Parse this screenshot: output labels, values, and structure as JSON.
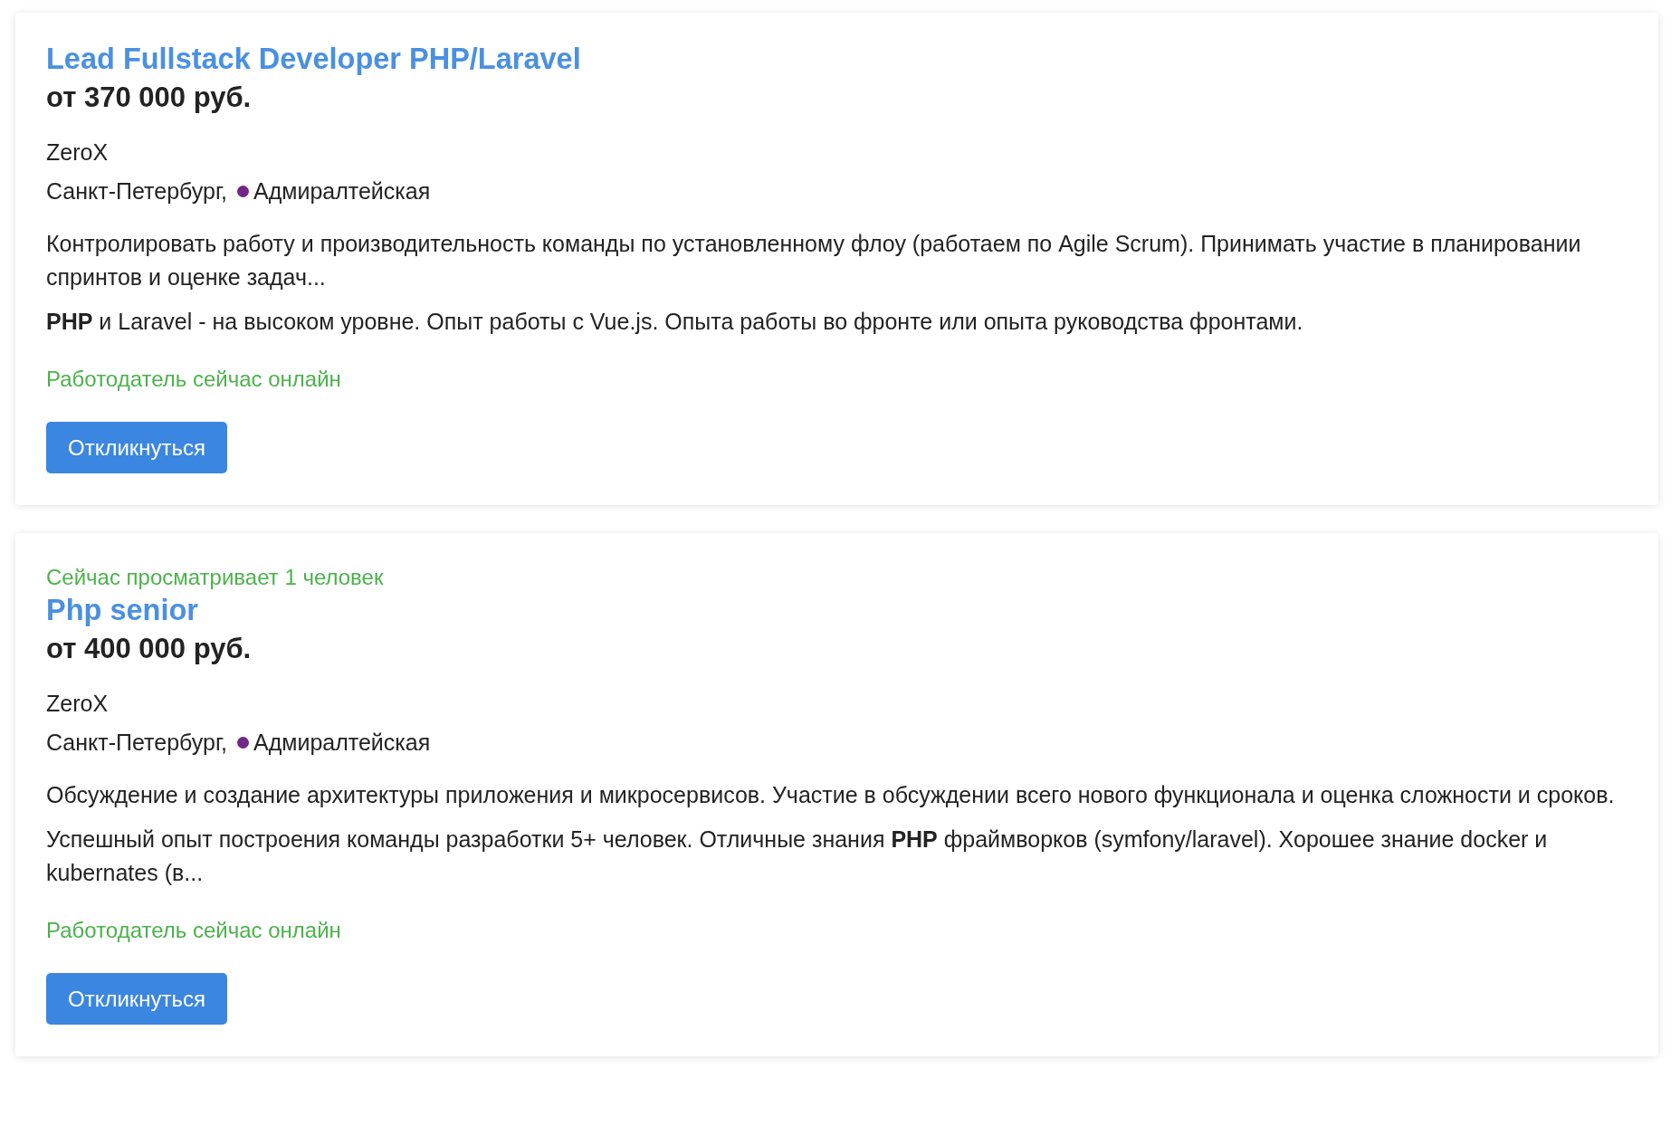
{
  "vacancies": [
    {
      "title": "Lead Fullstack Developer PHP/Laravel",
      "salary": "от 370 000 руб.",
      "company": "ZeroX",
      "city": "Санкт-Петербург,",
      "metro": {
        "station": "Адмиралтейская",
        "color": "#702785"
      },
      "responsibility": "Контролировать работу и производительность команды по установленному флоу (работаем по Agile Scrum). Принимать участие в планировании спринтов и оценке задач...",
      "requirement": "**PHP** и Laravel - на высоком уровне. Опыт работы с Vue.js. Опыта работы во фронте или опыта руководства фронтами.",
      "online": "Работодатель сейчас онлайн",
      "button": "Откликнуться"
    },
    {
      "viewers": "Сейчас просматривает 1 человек",
      "title": "Php senior",
      "salary": "от 400 000 руб.",
      "company": "ZeroX",
      "city": "Санкт-Петербург,",
      "metro": {
        "station": "Адмиралтейская",
        "color": "#702785"
      },
      "responsibility": "Обсуждение и создание архитектуры приложения и микросервисов. Участие в обсуждении всего нового функционала и оценка сложности и сроков.",
      "requirement": "Успешный опыт построения команды разработки 5+ человек. Отличные знания **PHP** фраймворков (symfony/laravel). Хорошее знание docker и kubernates (в...",
      "online": "Работодатель сейчас онлайн",
      "button": "Откликнуться"
    }
  ]
}
